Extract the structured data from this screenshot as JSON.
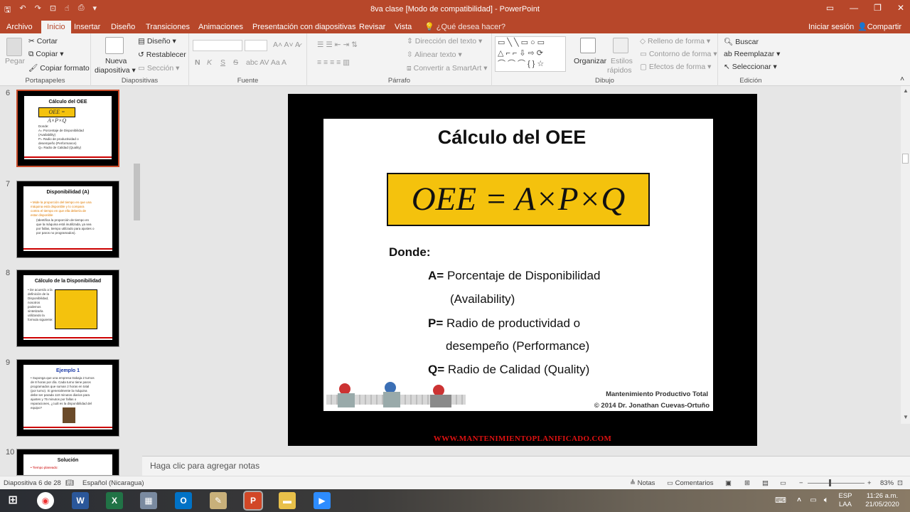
{
  "titlebar": {
    "title": "8va clase [Modo de compatibilidad] - PowerPoint"
  },
  "tabs": [
    "Archivo",
    "Inicio",
    "Insertar",
    "Diseño",
    "Transiciones",
    "Animaciones",
    "Presentación con diapositivas",
    "Revisar",
    "Vista",
    "¿Qué desea hacer?"
  ],
  "account": {
    "signin": "Iniciar sesión",
    "share": "Compartir"
  },
  "ribbon": {
    "portapapeles": {
      "label": "Portapapeles",
      "pegar": "Pegar",
      "cortar": "Cortar",
      "copiar": "Copiar",
      "copiar_formato": "Copiar formato"
    },
    "diapositivas": {
      "label": "Diapositivas",
      "nueva": "Nueva",
      "diapositiva": "diapositiva",
      "diseno": "Diseño",
      "restablecer": "Restablecer",
      "seccion": "Sección"
    },
    "fuente": {
      "label": "Fuente",
      "n": "N",
      "k": "K",
      "s": "S",
      "strike": "S"
    },
    "parrafo": {
      "label": "Párrafo",
      "direccion": "Dirección del texto",
      "alinear": "Alinear texto",
      "smartart": "Convertir a SmartArt"
    },
    "dibujo": {
      "label": "Dibujo",
      "organizar": "Organizar",
      "estilos": "Estilos",
      "rapidos": "rápidos",
      "relleno": "Relleno de forma",
      "contorno": "Contorno de forma",
      "efectos": "Efectos de forma"
    },
    "edicion": {
      "label": "Edición",
      "buscar": "Buscar",
      "reemplazar": "Reemplazar",
      "seleccionar": "Seleccionar"
    }
  },
  "thumbs": [
    {
      "num": "6",
      "title": "Cálculo del OEE"
    },
    {
      "num": "7",
      "title": "Disponibilidad (A)"
    },
    {
      "num": "8",
      "title": "Cálculo de la Disponibilidad"
    },
    {
      "num": "9",
      "title": "Ejemplo 1"
    },
    {
      "num": "10",
      "title": "Solución"
    }
  ],
  "slide": {
    "title": "Cálculo del OEE",
    "formula": "OEE = A×P×Q",
    "donde": "Donde:",
    "a_key": "A=",
    "a_text": "Porcentaje de Disponibilidad",
    "a_text2": "(Availability)",
    "p_key": "P=",
    "p_text": "Radio de productividad o",
    "p_text2": "desempeño (Performance)",
    "q_key": "Q=",
    "q_text": "Radio de Calidad (Quality)",
    "footer1": "Mantenimiento Productivo Total",
    "footer2": "© 2014 Dr. Jonathan Cuevas-Ortuño",
    "website": "WWW.MANTENIMIENTOPLANIFICADO.COM"
  },
  "notes": {
    "placeholder": "Haga clic para agregar notas"
  },
  "status": {
    "slide": "Diapositiva 6 de 28",
    "lang": "Español (Nicaragua)",
    "notas": "Notas",
    "comentarios": "Comentarios",
    "zoom": "83%"
  },
  "taskbar": {
    "lang1": "ESP",
    "lang2": "LAA",
    "time": "11:26 a.m.",
    "date": "21/05/2020"
  },
  "colors": {
    "accent": "#b7472a",
    "formula_bg": "#f4c20d"
  }
}
